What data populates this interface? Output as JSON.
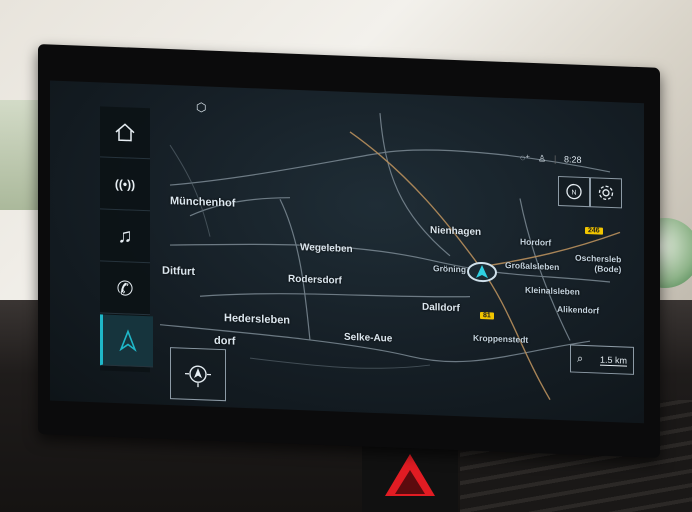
{
  "map": {
    "places": [
      {
        "id": "muenchenhof",
        "label": "Münchenhof"
      },
      {
        "id": "nienhagen",
        "label": "Nienhagen"
      },
      {
        "id": "hordorf",
        "label": "Hordorf"
      },
      {
        "id": "oschersleben",
        "label": "Oschersleb\n(Bode)"
      },
      {
        "id": "wegeleben",
        "label": "Wegeleben"
      },
      {
        "id": "groningen",
        "label": "Gröning"
      },
      {
        "id": "grossalsleben",
        "label": "Großalsleben"
      },
      {
        "id": "ditfurt",
        "label": "Ditfurt"
      },
      {
        "id": "rodersdorf",
        "label": "Rodersdorf"
      },
      {
        "id": "kleinalsleben",
        "label": "Kleinalsleben"
      },
      {
        "id": "dalldorf",
        "label": "Dalldorf"
      },
      {
        "id": "alikendorf",
        "label": "Alikendorf"
      },
      {
        "id": "hedersleben",
        "label": "Hedersleben"
      },
      {
        "id": "dorf",
        "label": "dorf"
      },
      {
        "id": "selke_aue",
        "label": "Selke-Aue"
      },
      {
        "id": "kroppenstedt",
        "label": "Kroppenstedt"
      }
    ],
    "road_badges": {
      "b246": "246",
      "b81": "81"
    },
    "scale_label": "1.5 km"
  },
  "status_bar": {
    "time": "8:28"
  },
  "nav": {
    "items": [
      "home",
      "radio",
      "music",
      "phone",
      "navigation"
    ],
    "active": "navigation"
  },
  "colors": {
    "accent": "#1fb7c8",
    "road_badge": "#f2c500",
    "hazard": "#e21c23"
  }
}
